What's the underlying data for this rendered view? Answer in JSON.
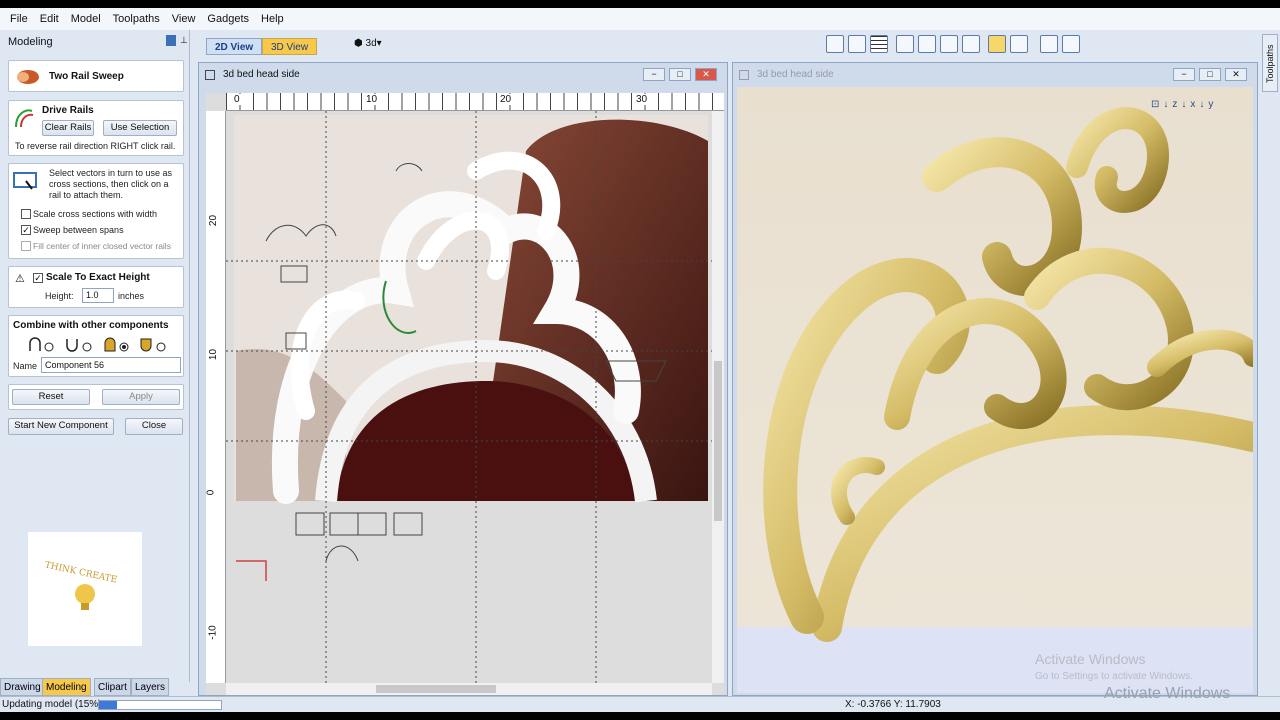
{
  "menu": [
    "File",
    "Edit",
    "Model",
    "Toolpaths",
    "View",
    "Gadgets",
    "Help"
  ],
  "panel": {
    "title": "Modeling",
    "tool_title": "Two Rail Sweep",
    "drive_rails": {
      "heading": "Drive Rails",
      "clear": "Clear Rails",
      "use_selection": "Use Selection",
      "hint": "To reverse rail direction RIGHT click rail."
    },
    "cross": {
      "hint": "Select vectors in turn to use as cross sections, then click on a rail to attach them.",
      "scale": "Scale cross sections with width",
      "sweep": "Sweep between spans",
      "fill": "Fill center of inner closed vector rails"
    },
    "height": {
      "label": "Scale To Exact Height",
      "height_label": "Height:",
      "height_value": "1.0",
      "units": "inches"
    },
    "combine": {
      "heading": "Combine with other components",
      "name_label": "Name",
      "name_value": "Component 56"
    },
    "reset": "Reset",
    "apply": "Apply",
    "start_new": "Start New Component",
    "close": "Close"
  },
  "bottom_tabs": [
    "Drawing",
    "Modeling",
    "Clipart",
    "Layers"
  ],
  "logo_text": "THINK CREATE",
  "view_tabs": {
    "tab2d": "2D View",
    "tab3d": "3D View",
    "dropdown": "3d"
  },
  "window2d": {
    "title": "3d bed head side",
    "ruler_top": [
      "0",
      "10",
      "20",
      "30"
    ],
    "ruler_left": [
      "20",
      "10",
      "0",
      "-10"
    ]
  },
  "window3d": {
    "title": "3d bed head side"
  },
  "watermark": {
    "title": "Activate Windows",
    "sub": "Go to Settings to activate Windows.",
    "ghost": "Activate Windows"
  },
  "side_tab": "Toolpaths",
  "status": {
    "text": "Updating model (15%)",
    "progress": 0.15,
    "coords": "X: -0.3766 Y: 11.7903"
  },
  "colors": {
    "accent": "#f7c84a",
    "carving": "#d4bb66",
    "panel": "#dfe7f2"
  }
}
